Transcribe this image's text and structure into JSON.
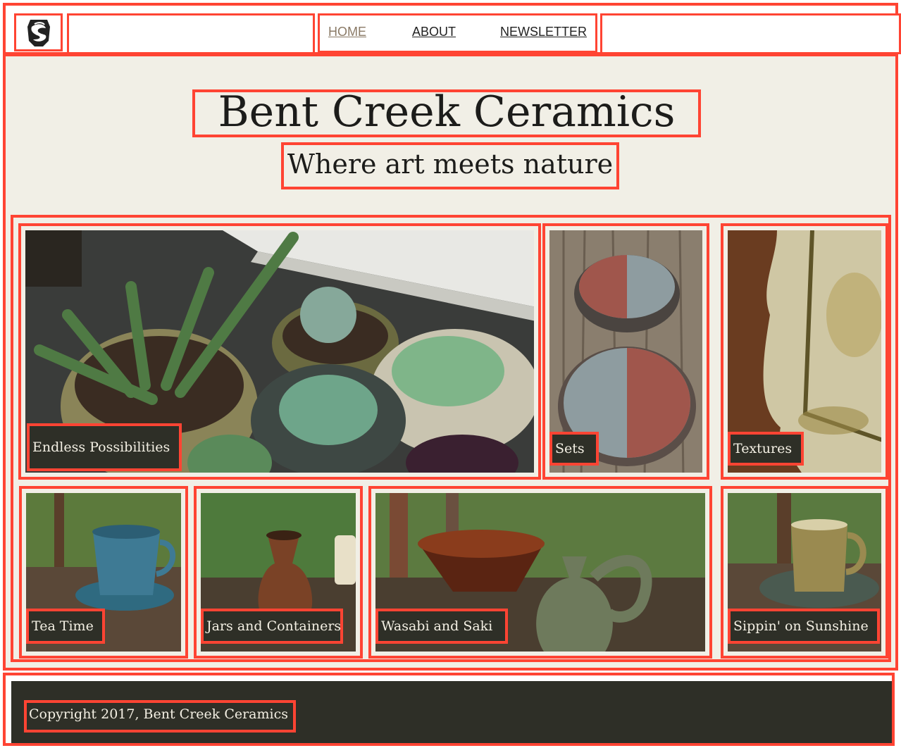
{
  "nav": {
    "logo_icon": "swirl-pottery-logo-icon",
    "items": [
      {
        "label": "HOME",
        "active": true
      },
      {
        "label": "ABOUT",
        "active": false
      },
      {
        "label": "NEWSLETTER",
        "active": false
      }
    ]
  },
  "hero": {
    "title": "Bent Creek Ceramics",
    "subtitle": "Where art meets nature"
  },
  "gallery": {
    "tiles": [
      {
        "caption": "Endless Possibilities",
        "photo": "succulents-in-ceramic-pots"
      },
      {
        "caption": "Sets",
        "photo": "two-bowls-on-wood"
      },
      {
        "caption": "Textures",
        "photo": "textured-glazed-dish"
      },
      {
        "caption": "Tea Time",
        "photo": "blue-teacup-saucer"
      },
      {
        "caption": "Jars and Containers",
        "photo": "brown-jar-with-cork"
      },
      {
        "caption": "Wasabi and Saki",
        "photo": "bowl-and-jug"
      },
      {
        "caption": "Sippin' on Sunshine",
        "photo": "mug-on-saucer"
      }
    ]
  },
  "footer": {
    "copyright": "Copyright 2017, Bent Creek Ceramics"
  },
  "colors": {
    "background": "#f1efe6",
    "footer_bg": "#2e2f27",
    "caption_bg": "#2e2f27",
    "caption_text": "#f4f0e4",
    "nav_active": "#8a7a66",
    "annotation_outline": "#ff4433"
  }
}
